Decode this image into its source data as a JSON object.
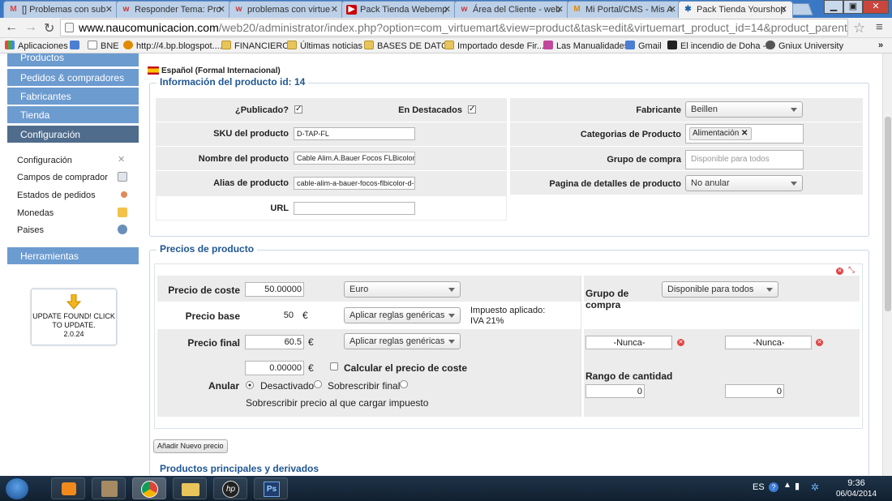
{
  "tabs": [
    {
      "label": "[] Problemas con sub",
      "icon": "gmail-icon",
      "color": "#d44"
    },
    {
      "label": "Responder Tema: Pro",
      "icon": "w-icon",
      "color": "#c33"
    },
    {
      "label": "problemas con virtue",
      "icon": "w-icon",
      "color": "#c33"
    },
    {
      "label": "Pack Tienda Webemp",
      "icon": "youtube-icon",
      "color": "#c00"
    },
    {
      "label": "Área del Cliente - web",
      "icon": "w-icon",
      "color": "#c33"
    },
    {
      "label": "Mi Portal/CMS - Mis A",
      "icon": "mp-icon",
      "color": "#e08a00"
    },
    {
      "label": "Pack Tienda Yourshop",
      "icon": "joomla-icon",
      "color": "#1c5fa8"
    }
  ],
  "address": {
    "host": "www.naucomunicacion.com",
    "path": "/web20/administrator/index.php?option=com_virtuemart&view=product&task=edit&virtuemart_product_id=14&product_parent_id=0"
  },
  "bookmarks": [
    {
      "label": "Aplicaciones",
      "icon": "apps-icon"
    },
    {
      "label": "",
      "icon": "bookmark-icon"
    },
    {
      "label": "BNE",
      "icon": "doc-icon"
    },
    {
      "label": "http://4.bp.blogspot....",
      "icon": "globe-icon"
    },
    {
      "label": "FINANCIERO",
      "icon": "folder-icon"
    },
    {
      "label": "Últimas noticias",
      "icon": "folder-icon"
    },
    {
      "label": "BASES DE DATOS",
      "icon": "folder-icon"
    },
    {
      "label": "Importado desde Fir...",
      "icon": "folder-icon"
    },
    {
      "label": "Las Manualidades",
      "icon": "m-icon"
    },
    {
      "label": "Gmail",
      "icon": "google-icon"
    },
    {
      "label": "El incendio de Doha -...",
      "icon": "abc-icon"
    },
    {
      "label": "Gniux University",
      "icon": "g-icon"
    }
  ],
  "sidebar": {
    "top": [
      {
        "label": "Productos"
      },
      {
        "label": "Pedidos & compradores"
      },
      {
        "label": "Fabricantes"
      },
      {
        "label": "Tienda"
      },
      {
        "label": "Configuración"
      }
    ],
    "items": [
      {
        "label": "Configuración"
      },
      {
        "label": "Campos de comprador"
      },
      {
        "label": "Estados de pedidos"
      },
      {
        "label": "Monedas"
      },
      {
        "label": "Paises"
      }
    ],
    "tools": "Herramientas",
    "update": {
      "line1": "UPDATE FOUND! CLICK",
      "line2": "TO UPDATE.",
      "line3": "2.0.24"
    }
  },
  "product": {
    "language": "Español (Formal Internacional)",
    "legend": "Información del producto id: 14",
    "published_label": "¿Publicado?",
    "published": true,
    "featured_label": "En Destacados",
    "featured": true,
    "sku_label": "SKU del producto",
    "sku": "D-TAP-FL",
    "name_label": "Nombre del producto",
    "name": "Cable Alim.A.Bauer Focos FLBicolor D",
    "alias_label": "Alias de producto",
    "alias": "cable-alim-a-bauer-focos-flbicolor-d-ta",
    "url_label": "URL",
    "url": "",
    "manufacturer_label": "Fabricante",
    "manufacturer": "Beillen",
    "categories_label": "Categorias de Producto",
    "category": "Alimentación",
    "group_label": "Grupo de compra",
    "group_placeholder": "Disponible para todos",
    "details_label": "Pagina de detalles de producto",
    "details": "No anular"
  },
  "prices": {
    "legend": "Precios de producto",
    "cost_label": "Precio de coste",
    "cost": "50.00000",
    "currency": "Euro",
    "base_label": "Precio base",
    "base": "50",
    "euro": "€",
    "rules1": "Aplicar reglas genéricas",
    "tax_applied": "Impuesto aplicado:",
    "tax_name": "IVA 21%",
    "final_label": "Precio final",
    "final": "60.5",
    "rules2": "Aplicar reglas genéricas",
    "override_label": "Anular",
    "override_value": "0.00000",
    "calc_cost_label": "Calcular el precio de coste",
    "opt_disabled": "Desactivado",
    "opt_final": "Sobrescribir final",
    "opt_tax": "Sobrescribir precio al que cargar impuesto",
    "group_label": "Grupo de compra",
    "group": "Disponible para todos",
    "never1": "-Nunca-",
    "never2": "-Nunca-",
    "qty_label": "Rango de cantidad",
    "qty_from": "0",
    "qty_to": "0",
    "add_price": "Añadir Nuevo precio"
  },
  "next_section": "Productos principales y derivados",
  "taskbar": {
    "lang": "ES",
    "time": "9:36",
    "date": "06/04/2014"
  }
}
